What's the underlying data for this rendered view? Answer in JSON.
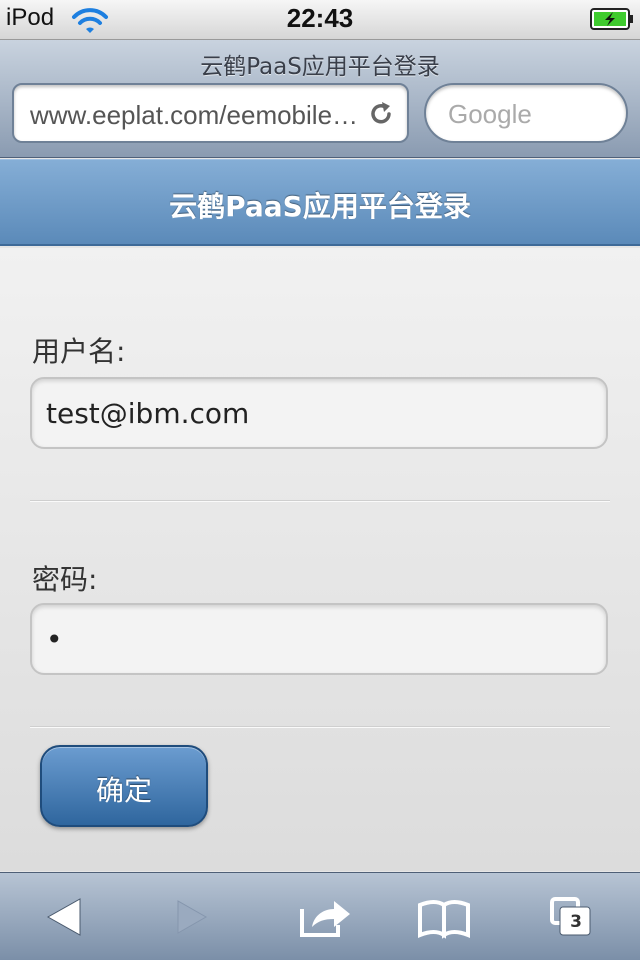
{
  "status_bar": {
    "carrier": "iPod",
    "time": "22:43",
    "wifi_icon": "wifi-icon",
    "battery_icon": "battery-charging-icon"
  },
  "browser": {
    "page_title": "云鹤PaaS应用平台登录",
    "url": "www.eeplat.com/eemobile/mobile/login.jsp",
    "search_placeholder": "Google",
    "reload_icon": "reload-icon"
  },
  "app": {
    "header_title": "云鹤PaaS应用平台登录",
    "header_color": "#6e9bc8"
  },
  "form": {
    "username_label": "用户名:",
    "username_value": "test@ibm.com",
    "password_label": "密码:",
    "password_value": "•",
    "submit_label": "确定",
    "button_color": "#3f76ad"
  },
  "toolbar": {
    "back_icon": "back-arrow-icon",
    "forward_icon": "forward-arrow-icon",
    "share_icon": "share-icon",
    "bookmarks_icon": "bookmarks-icon",
    "tabs_icon": "tabs-icon",
    "tabs_count": "3"
  }
}
